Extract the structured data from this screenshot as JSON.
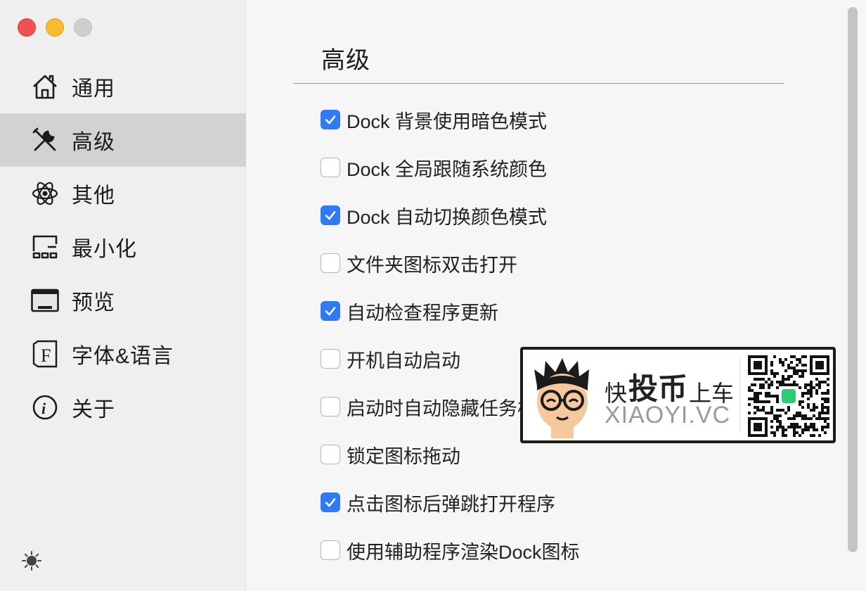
{
  "window": {
    "traffic_lights": [
      "close",
      "minimize",
      "zoom"
    ]
  },
  "sidebar": {
    "items": [
      {
        "label": "通用",
        "icon": "house-icon",
        "active": false
      },
      {
        "label": "高级",
        "icon": "tools-icon",
        "active": true
      },
      {
        "label": "其他",
        "icon": "atom-icon",
        "active": false
      },
      {
        "label": "最小化",
        "icon": "minimize-icon",
        "active": false
      },
      {
        "label": "预览",
        "icon": "preview-icon",
        "active": false
      },
      {
        "label": "字体&语言",
        "icon": "font-icon",
        "active": false
      },
      {
        "label": "关于",
        "icon": "info-icon",
        "active": false
      }
    ],
    "footer_icon": "brightness-icon"
  },
  "main": {
    "title": "高级",
    "options": [
      {
        "label": "Dock 背景使用暗色模式",
        "checked": true
      },
      {
        "label": "Dock 全局跟随系统颜色",
        "checked": false
      },
      {
        "label": "Dock 自动切换颜色模式",
        "checked": true
      },
      {
        "label": "文件夹图标双击打开",
        "checked": false
      },
      {
        "label": "自动检查程序更新",
        "checked": true
      },
      {
        "label": "开机自动启动",
        "checked": false
      },
      {
        "label": "启动时自动隐藏任务栏",
        "checked": false
      },
      {
        "label": "锁定图标拖动",
        "checked": false
      },
      {
        "label": "点击图标后弹跳打开程序",
        "checked": true
      },
      {
        "label": "使用辅助程序渲染Dock图标",
        "checked": false
      }
    ]
  },
  "watermark": {
    "prefix": "快",
    "highlight": "投币",
    "suffix": "上车",
    "url": "XIAOYI.VC",
    "accent": "#2ecc71"
  },
  "colors": {
    "accent": "#2f7bf5",
    "sidebar_active": "#d2d2d4"
  }
}
